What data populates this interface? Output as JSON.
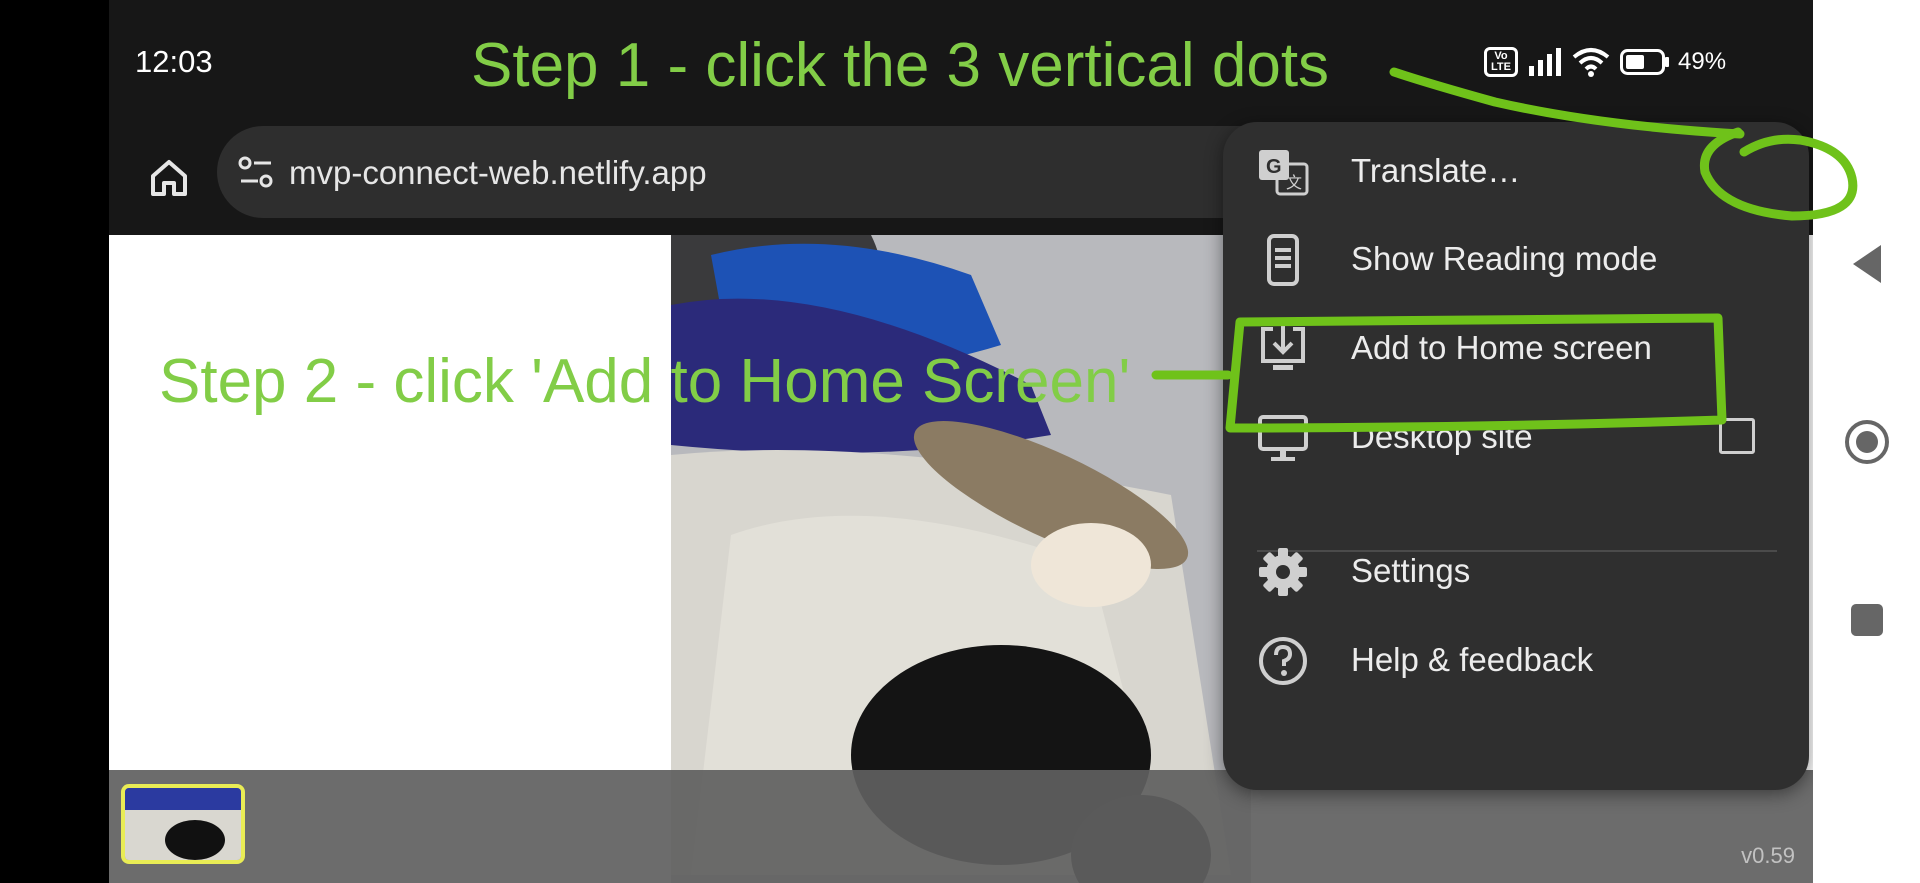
{
  "status_bar": {
    "time": "12:03",
    "network_badge_top": "Vo",
    "network_badge_bottom": "LTE",
    "battery_percent": "49%"
  },
  "toolbar": {
    "url": "mvp-connect-web.netlify.app"
  },
  "menu": {
    "items": [
      {
        "label": "Translate…",
        "icon": "translate-icon"
      },
      {
        "label": "Show Reading mode",
        "icon": "reading-mode-icon"
      },
      {
        "label": "Add to Home screen",
        "icon": "add-to-home-icon"
      },
      {
        "label": "Desktop site",
        "icon": "desktop-icon",
        "checked": false
      },
      {
        "label": "Settings",
        "icon": "gear-icon"
      },
      {
        "label": "Help & feedback",
        "icon": "help-icon"
      }
    ]
  },
  "page": {
    "version": "v0.59"
  },
  "annotations": {
    "step1": "Step 1 - click the 3 vertical dots",
    "step2": "Step 2 - click 'Add to Home Screen'",
    "highlight_color": "#6fc21a",
    "text_color": "#82cd47"
  }
}
